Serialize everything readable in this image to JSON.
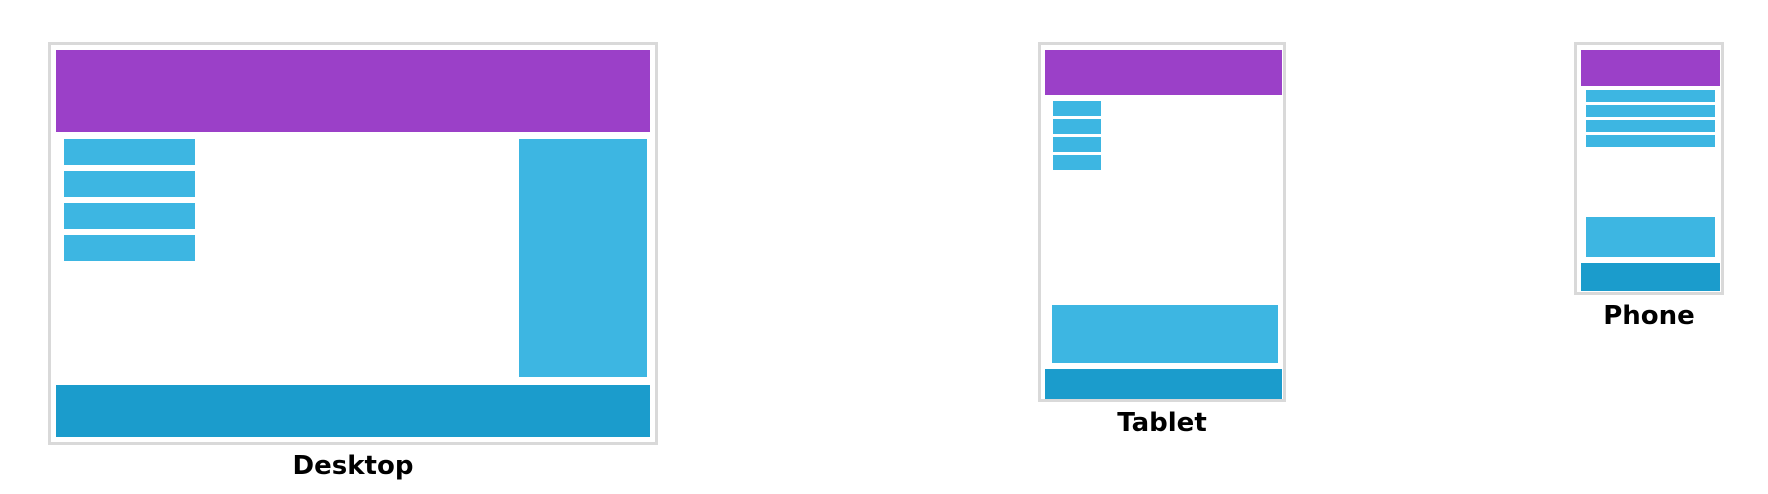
{
  "colors": {
    "header": "#9b40c8",
    "block": "#3db6e2",
    "footer": "#1b9ccc",
    "frame_border": "#d9d9d9"
  },
  "layouts": [
    {
      "caption": "Desktop"
    },
    {
      "caption": "Tablet"
    },
    {
      "caption": "Phone"
    }
  ]
}
